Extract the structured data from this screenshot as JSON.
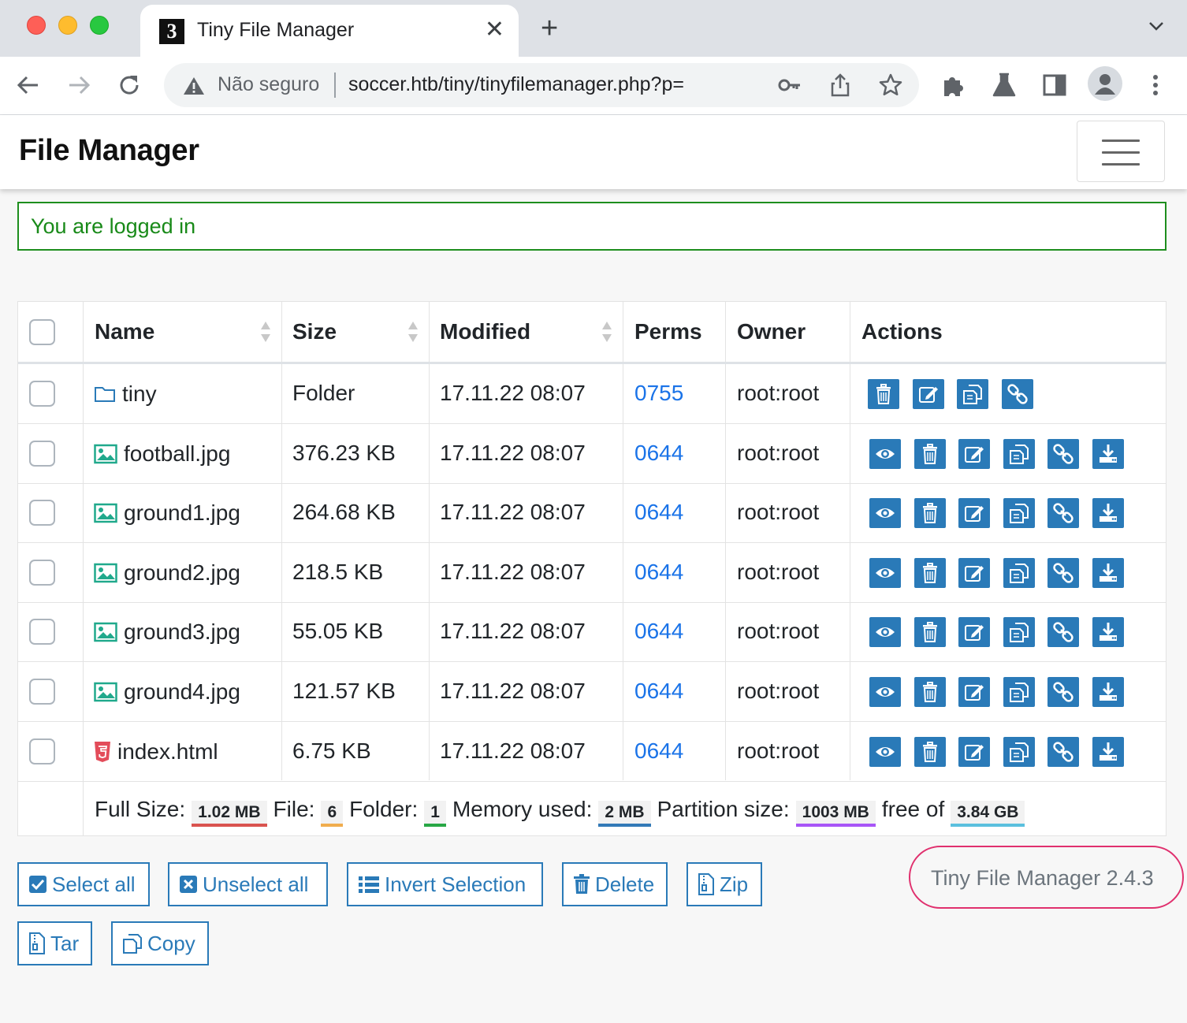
{
  "browser": {
    "tab_title": "Tiny File Manager",
    "tab_favicon_text": "3",
    "close_glyph": "✕",
    "newtab_glyph": "+",
    "not_secure": "Não seguro",
    "url": "soccer.htb/tiny/tinyfilemanager.php?p="
  },
  "app": {
    "brand": "File Manager",
    "alert": "You are logged in"
  },
  "table": {
    "headers": {
      "name": "Name",
      "size": "Size",
      "modified": "Modified",
      "perms": "Perms",
      "owner": "Owner",
      "actions": "Actions"
    },
    "rows": [
      {
        "name": "tiny",
        "type": "folder-icon",
        "size": "Folder",
        "modified": "17.11.22 08:07",
        "perms": "0755",
        "owner": "root:root"
      },
      {
        "name": "football.jpg",
        "type": "image-file-icon",
        "size": "376.23 KB",
        "modified": "17.11.22 08:07",
        "perms": "0644",
        "owner": "root:root"
      },
      {
        "name": "ground1.jpg",
        "type": "image-file-icon",
        "size": "264.68 KB",
        "modified": "17.11.22 08:07",
        "perms": "0644",
        "owner": "root:root"
      },
      {
        "name": "ground2.jpg",
        "type": "image-file-icon",
        "size": "218.5 KB",
        "modified": "17.11.22 08:07",
        "perms": "0644",
        "owner": "root:root"
      },
      {
        "name": "ground3.jpg",
        "type": "image-file-icon",
        "size": "55.05 KB",
        "modified": "17.11.22 08:07",
        "perms": "0644",
        "owner": "root:root"
      },
      {
        "name": "ground4.jpg",
        "type": "image-file-icon",
        "size": "121.57 KB",
        "modified": "17.11.22 08:07",
        "perms": "0644",
        "owner": "root:root"
      },
      {
        "name": "index.html",
        "type": "html5-file-icon",
        "size": "6.75 KB",
        "modified": "17.11.22 08:07",
        "perms": "0644",
        "owner": "root:root"
      }
    ],
    "footer": {
      "full_size_label": "Full Size:",
      "full_size": "1.02 MB",
      "file_label": "File:",
      "file_count": "6",
      "folder_label": "Folder:",
      "folder_count": "1",
      "memory_label": "Memory used:",
      "memory": "2 MB",
      "partition_label": "Partition size:",
      "partition": "1003 MB",
      "free_label": "free of",
      "free": "3.84 GB"
    }
  },
  "buttons": {
    "select_all": "Select all",
    "unselect_all": "Unselect all",
    "invert": "Invert Selection",
    "delete": "Delete",
    "zip": "Zip",
    "tar": "Tar",
    "copy": "Copy"
  },
  "version": "Tiny File Manager 2.4.3",
  "colors": {
    "action_blue": "#2a7ab8",
    "perm_link": "#1a73e8",
    "alert_green": "#198a19",
    "badge_full_size": "#d9534f",
    "badge_file": "#f0ad4e",
    "badge_folder": "#28a745",
    "badge_memory": "#337ab7",
    "badge_partition": "#a855f7",
    "badge_free": "#5bc0de",
    "version_border": "#e0306e"
  }
}
